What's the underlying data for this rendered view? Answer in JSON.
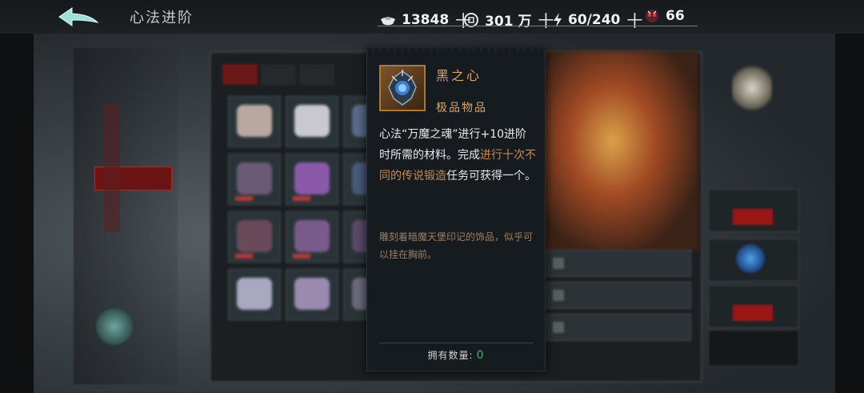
{
  "header": {
    "title": "心法进阶",
    "resources": [
      {
        "icon": "silver-ingot-icon",
        "value": "13848"
      },
      {
        "icon": "coin-icon",
        "value": "301 万"
      },
      {
        "icon": "stamina-lightning-icon",
        "value": "60/240"
      },
      {
        "icon": "demon-mask-icon",
        "value": "66"
      }
    ]
  },
  "tooltip": {
    "item_name": "黑之心",
    "item_grade": "极品物品",
    "desc_part1": "心法“万魔之魂”进行+10进阶时所需的材料。完成",
    "desc_highlight": "进行十次不同的传说锻造",
    "desc_part2": "任务可获得一个。",
    "lore": "雕刻着暗魔天堡印记的饰品，似乎可以挂在胸前。",
    "own_label": "拥有数量:",
    "own_count": "0"
  },
  "colors": {
    "gold_text": "#d7a56a",
    "highlight": "#c88a50",
    "lore": "#9e7e63",
    "count": "#3fb37a"
  }
}
